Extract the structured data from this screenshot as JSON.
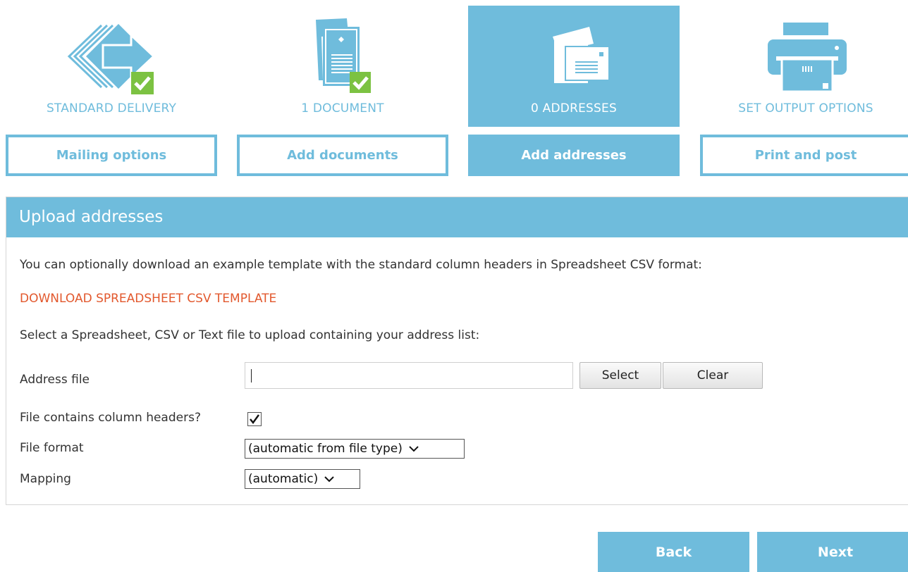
{
  "colors": {
    "accent": "#6fbcdc",
    "check_green": "#7cc242",
    "link": "#e2582d"
  },
  "steps": [
    {
      "icon": "delivery-arrow-icon",
      "caption": "STANDARD DELIVERY",
      "button": "Mailing options",
      "completed": true
    },
    {
      "icon": "document-icon",
      "caption": "1 DOCUMENT",
      "button": "Add documents",
      "completed": true
    },
    {
      "icon": "envelopes-icon",
      "caption": "0 ADDRESSES",
      "button": "Add addresses",
      "active": true
    },
    {
      "icon": "printer-icon",
      "caption": "SET OUTPUT OPTIONS",
      "button": "Print and post"
    }
  ],
  "panel": {
    "title": "Upload addresses",
    "intro": "You can optionally download an example template with the standard column headers in Spreadsheet CSV format:",
    "download_link": "DOWNLOAD SPREADSHEET CSV TEMPLATE",
    "select_instruction": "Select a Spreadsheet, CSV or Text file to upload containing your address list:",
    "address_file": {
      "label": "Address file",
      "value": "",
      "select_label": "Select",
      "clear_label": "Clear"
    },
    "column_headers": {
      "label": "File contains column headers?",
      "checked": true
    },
    "file_format": {
      "label": "File format",
      "selected": "(automatic from file type)"
    },
    "mapping": {
      "label": "Mapping",
      "selected": "(automatic)"
    }
  },
  "nav": {
    "back_label": "Back",
    "next_label": "Next"
  }
}
